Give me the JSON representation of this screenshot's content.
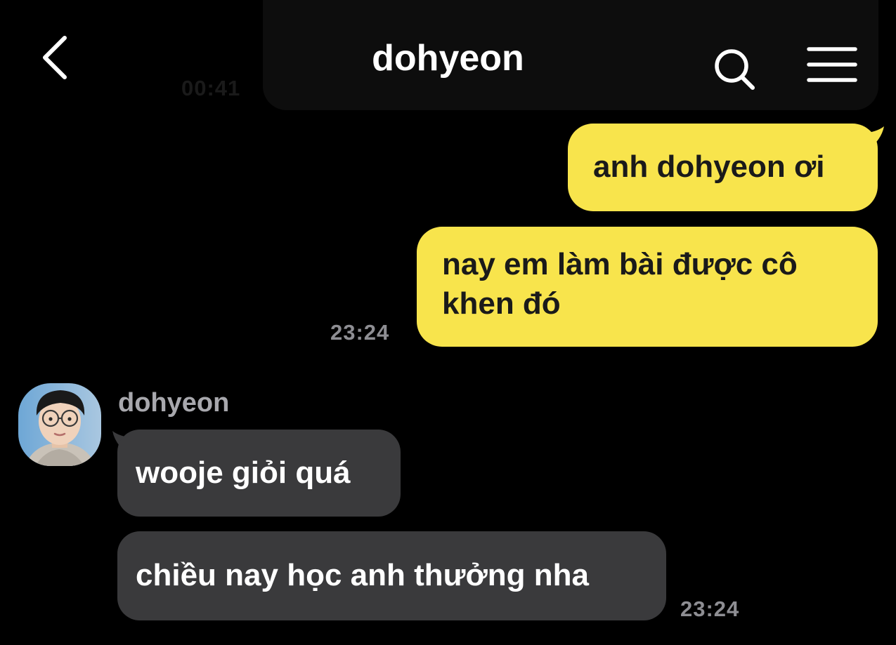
{
  "header": {
    "title": "dohyeon",
    "ghost_time": "00:41",
    "back_icon": "chevron-left-icon",
    "search_icon": "search-icon",
    "menu_icon": "hamburger-menu-icon"
  },
  "colors": {
    "background": "#000000",
    "outgoing_bubble": "#f8e44c",
    "incoming_bubble": "#3a3a3c",
    "timestamp": "#8e8e93"
  },
  "messages": [
    {
      "direction": "outgoing",
      "text": "anh dohyeon ơi"
    },
    {
      "direction": "outgoing",
      "lines": [
        "nay em làm bài được cô",
        "khen đó"
      ],
      "time": "23:24"
    },
    {
      "direction": "incoming",
      "sender": "dohyeon",
      "text": "wooje giỏi quá"
    },
    {
      "direction": "incoming",
      "text": "chiều nay học anh thưởng nha",
      "time": "23:24"
    }
  ]
}
